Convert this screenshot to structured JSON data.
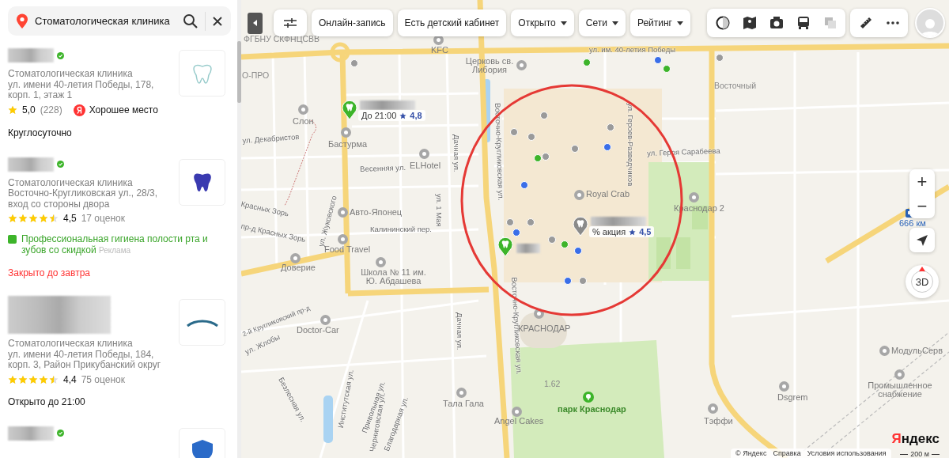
{
  "search": {
    "value": "Стоматологическая клиника"
  },
  "results": [
    {
      "verified": true,
      "category": "Стоматологическая клиника",
      "address": "ул. имени 40-летия Победы, 178, корп. 1, этаж 1",
      "rating": {
        "kind": "single",
        "score": "5,0",
        "count": "(228)"
      },
      "badge": "Хорошее место",
      "hours": {
        "text": "Круглосуточно",
        "closed": false
      }
    },
    {
      "verified": true,
      "category": "Стоматологическая клиника",
      "address": "Восточно-Кругликовская ул., 28/3, вход со стороны двора",
      "rating": {
        "kind": "row",
        "stars": 4.5,
        "score": "4,5",
        "count": "17 оценок"
      },
      "ad": {
        "text": "Профессиональная гигиена полости рта и зубов со скидкой",
        "label": "Реклама"
      },
      "hours": {
        "text": "Закрыто до завтра",
        "closed": true
      }
    },
    {
      "verified": false,
      "category": "Стоматологическая клиника",
      "address": "ул. имени 40-летия Победы, 184, корп. 3, Район Прикубанский округ",
      "rating": {
        "kind": "row",
        "stars": 4.5,
        "score": "4,4",
        "count": "75 оценок"
      },
      "hours": {
        "text": "Открыто до 21:00",
        "closed": false
      }
    },
    {
      "verified": true
    }
  ],
  "filters": [
    {
      "label": "Онлайн-запись",
      "dropdown": false
    },
    {
      "label": "Есть детский кабинет",
      "dropdown": false
    },
    {
      "label": "Открыто",
      "dropdown": true
    },
    {
      "label": "Сети",
      "dropdown": true
    },
    {
      "label": "Рейтинг",
      "dropdown": true
    }
  ],
  "map": {
    "labels": [
      {
        "text": "ФГБНУ СКФНЦСВВ",
        "kind": "place"
      },
      {
        "text": "KFC",
        "kind": "poi"
      },
      {
        "text": "О-ПРО",
        "kind": "place"
      },
      {
        "text": "Церковь св. Либория",
        "kind": "poi"
      },
      {
        "text": "ул. им. 40-летия Победы",
        "kind": "street"
      },
      {
        "text": "Восточный",
        "kind": "place"
      },
      {
        "text": "Слон",
        "kind": "poi"
      },
      {
        "text": "Бастурма",
        "kind": "poi"
      },
      {
        "text": "ул. Декабристов",
        "kind": "street"
      },
      {
        "text": "Весенняя ул.",
        "kind": "street"
      },
      {
        "text": "ELHotel",
        "kind": "poi"
      },
      {
        "text": "Дачная ул.",
        "kind": "street"
      },
      {
        "text": "ул. 1 Мая",
        "kind": "street"
      },
      {
        "text": "Восточно-Кругликовская ул.",
        "kind": "street"
      },
      {
        "text": "Восточно-Кругликовская ул.",
        "kind": "street"
      },
      {
        "text": "ул. Героев-Разведчиков",
        "kind": "street"
      },
      {
        "text": "ул. Героя Сарабеева",
        "kind": "street"
      },
      {
        "text": "Royal Crab",
        "kind": "poi"
      },
      {
        "text": "Краснодар 2",
        "kind": "poi"
      },
      {
        "text": "666 км",
        "kind": "transit"
      },
      {
        "text": "Авто-Японец",
        "kind": "poi"
      },
      {
        "text": "ул. Жуковского",
        "kind": "street"
      },
      {
        "text": "Красных Зорь",
        "kind": "street"
      },
      {
        "text": "пр-д Красных Зорь",
        "kind": "street"
      },
      {
        "text": "Калининский пер.",
        "kind": "street"
      },
      {
        "text": "Food Travel",
        "kind": "poi"
      },
      {
        "text": "Доверие",
        "kind": "poi"
      },
      {
        "text": "Школа № 11 им. Ю. Абдашева",
        "kind": "poi"
      },
      {
        "text": "2-й Кругликовский пр-д",
        "kind": "street"
      },
      {
        "text": "Doctor-Car",
        "kind": "poi"
      },
      {
        "text": "ул. Жлобы",
        "kind": "street"
      },
      {
        "text": "КРАСНОДАР",
        "kind": "poi"
      },
      {
        "text": "1.62",
        "kind": "place"
      },
      {
        "text": "парк Краснодар",
        "kind": "park"
      },
      {
        "text": "Тала Гала",
        "kind": "poi"
      },
      {
        "text": "Angel Cakes",
        "kind": "poi"
      },
      {
        "text": "Тэффи",
        "kind": "poi"
      },
      {
        "text": "Dsgrem",
        "kind": "poi"
      },
      {
        "text": "МодульСерв",
        "kind": "poi"
      },
      {
        "text": "Промышленное снабжение",
        "kind": "poi"
      },
      {
        "text": "Институтская ул.",
        "kind": "street"
      },
      {
        "text": "Привольная ул.",
        "kind": "street"
      },
      {
        "text": "Безлесная ул.",
        "kind": "street"
      },
      {
        "text": "Черниговская ул.",
        "kind": "street"
      },
      {
        "text": "Благодарная ул.",
        "kind": "street"
      },
      {
        "text": "Дачная ул.",
        "kind": "street"
      }
    ],
    "dots": [
      {
        "color": "#9a9a9a"
      },
      {
        "color": "#9a9a9a"
      },
      {
        "color": "#9a9a9a"
      },
      {
        "color": "#9a9a9a"
      },
      {
        "color": "#9a9a9a"
      },
      {
        "color": "#9a9a9a"
      },
      {
        "color": "#9a9a9a"
      },
      {
        "color": "#9a9a9a"
      },
      {
        "color": "#9a9a9a"
      },
      {
        "color": "#9a9a9a"
      },
      {
        "color": "#9a9a9a"
      },
      {
        "color": "#9a9a9a"
      },
      {
        "color": "#3a6ee8"
      },
      {
        "color": "#3a6ee8"
      },
      {
        "color": "#3a6ee8"
      },
      {
        "color": "#3a6ee8"
      },
      {
        "color": "#3a6ee8"
      },
      {
        "color": "#3a6ee8"
      },
      {
        "color": "#3db42a"
      },
      {
        "color": "#3db42a"
      },
      {
        "color": "#3db42a"
      },
      {
        "color": "#3db42a"
      }
    ],
    "pins": [
      {
        "color": "#3db42a",
        "text": "До 21:00",
        "rating": "4,8"
      },
      {
        "color": "#3db42a"
      },
      {
        "color": "#8a8a8a",
        "text": "% акция",
        "rating": "4,5"
      }
    ],
    "zoom_in": "+",
    "zoom_out": "−",
    "mode_3d": "3D"
  },
  "footer": {
    "links": [
      "© Яндекс",
      "Справка",
      "Условия использования"
    ],
    "logo_first": "Я",
    "logo_rest": "ндекс",
    "scale": "200 м"
  }
}
